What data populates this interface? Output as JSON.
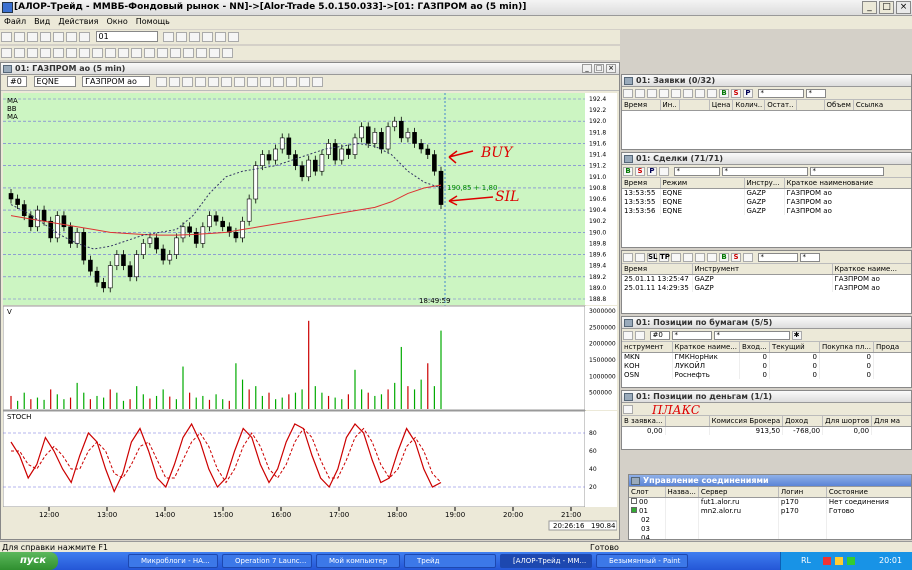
{
  "window": {
    "title": "[АЛОР-Трейд - ММВБ-Фондовый рынок - NN]->[Alor-Trade 5.0.150.033]->[01: ГАЗПРОМ ао (5 min)]"
  },
  "menu": [
    "Файл",
    "Вид",
    "Действия",
    "Окно",
    "Помощь"
  ],
  "toolbar": {
    "account_value": "01"
  },
  "chart_window": {
    "title": "01: ГАЗПРОМ ао (5 min)",
    "num_value": "#0",
    "board_value": "EQNE",
    "instrument_value": "ГАЗПРОМ ао",
    "labels": [
      "MA",
      "BB",
      "MA"
    ],
    "time_label": "18:49:59",
    "price_annotation": "190,85 + 1,80",
    "volume_label": "V",
    "stoch_label": "STOCH",
    "buy_note": "BUY",
    "sell_note": "SIL",
    "cursor_time": "20:26:16",
    "cursor_price": "190.84"
  },
  "chart_data": [
    {
      "type": "candlestick",
      "title": "ГАЗПРОМ ао (5 min)",
      "x_ticks": [
        "12:00",
        "13:00",
        "14:00",
        "15:00",
        "16:00",
        "17:00",
        "18:00",
        "19:00",
        "20:00",
        "21:00"
      ],
      "y_ticks": [
        188.8,
        189.0,
        189.2,
        189.4,
        189.6,
        189.8,
        190.0,
        190.2,
        190.4,
        190.6,
        190.8,
        191.0,
        191.2,
        191.4,
        191.6,
        191.8,
        192.0,
        192.2,
        192.4
      ],
      "ylim": [
        188.8,
        192.4
      ],
      "grid": true,
      "close": [
        190.6,
        190.5,
        190.3,
        190.1,
        190.4,
        190.2,
        189.9,
        190.3,
        190.1,
        189.8,
        190.0,
        189.5,
        189.3,
        189.1,
        189.0,
        189.4,
        189.6,
        189.4,
        189.2,
        189.6,
        189.8,
        189.9,
        189.7,
        189.5,
        189.6,
        189.9,
        190.1,
        190.0,
        189.8,
        190.1,
        190.3,
        190.2,
        190.1,
        190.0,
        189.9,
        190.2,
        190.6,
        191.2,
        191.4,
        191.3,
        191.5,
        191.7,
        191.4,
        191.2,
        191.0,
        191.3,
        191.1,
        191.4,
        191.6,
        191.3,
        191.5,
        191.4,
        191.7,
        191.9,
        191.6,
        191.8,
        191.5,
        191.9,
        192.0,
        191.7,
        191.8,
        191.6,
        191.5,
        191.4,
        191.1,
        190.5
      ],
      "ma_long": [
        190.3,
        190.25,
        190.2,
        190.15,
        190.1,
        190.05,
        190.0,
        189.98,
        189.96,
        189.95,
        189.95,
        189.96,
        189.98,
        190.0,
        190.05,
        190.1,
        190.15,
        190.2,
        190.25,
        190.3,
        190.35,
        190.4,
        190.45,
        190.55,
        190.7,
        190.8,
        190.85
      ],
      "ma_short": [
        190.5,
        190.35,
        190.15,
        189.95,
        189.8,
        189.7,
        189.75,
        189.85,
        189.95,
        190.0,
        190.05,
        190.3,
        190.7,
        191.0,
        191.1,
        191.15,
        191.2,
        191.3,
        191.4,
        191.5,
        191.55,
        191.6,
        191.55,
        191.4,
        191.1,
        190.9,
        190.8
      ]
    },
    {
      "type": "bar",
      "title": "V",
      "y_ticks": [
        500000,
        1000000,
        1500000,
        2000000,
        2500000,
        3000000
      ],
      "ylim": [
        0,
        3000000
      ],
      "values": [
        400000,
        250000,
        500000,
        300000,
        350000,
        280000,
        600000,
        450000,
        300000,
        350000,
        800000,
        500000,
        300000,
        400000,
        350000,
        600000,
        500000,
        250000,
        300000,
        700000,
        450000,
        320000,
        400000,
        600000,
        380000,
        300000,
        1300000,
        500000,
        350000,
        400000,
        280000,
        450000,
        300000,
        250000,
        1400000,
        900000,
        600000,
        700000,
        400000,
        500000,
        300000,
        350000,
        450000,
        500000,
        600000,
        2700000,
        700000,
        500000,
        400000,
        350000,
        300000,
        450000,
        1200000,
        600000,
        500000,
        400000,
        450000,
        600000,
        800000,
        1900000,
        700000,
        600000,
        900000,
        1400000,
        700000,
        2400000
      ]
    },
    {
      "type": "line",
      "title": "STOCH",
      "y_ticks": [
        20,
        40,
        60,
        80
      ],
      "ylim": [
        0,
        100
      ],
      "series": [
        {
          "values": [
            70,
            55,
            30,
            45,
            75,
            60,
            40,
            25,
            55,
            80,
            70,
            40,
            15,
            35,
            70,
            85,
            60,
            30,
            20,
            45,
            75,
            90,
            70,
            40,
            20,
            30,
            60,
            85,
            75,
            45,
            25,
            40,
            70,
            90,
            85,
            55,
            30,
            20,
            40,
            75,
            90,
            80,
            50,
            25,
            30,
            60,
            85,
            70,
            40,
            20,
            25
          ]
        },
        {
          "values": [
            60,
            60,
            45,
            40,
            55,
            65,
            55,
            40,
            40,
            60,
            70,
            60,
            35,
            30,
            45,
            65,
            70,
            50,
            30,
            30,
            50,
            70,
            80,
            65,
            40,
            25,
            40,
            65,
            80,
            65,
            40,
            30,
            45,
            70,
            85,
            75,
            50,
            30,
            30,
            50,
            75,
            85,
            70,
            45,
            30,
            40,
            65,
            75,
            60,
            35,
            25
          ]
        }
      ]
    }
  ],
  "orders_panel": {
    "title": "01: Заявки (0/32)",
    "dd1": "*",
    "dd2": "*",
    "headers": [
      "Время",
      "Ин..",
      "",
      "Цена",
      "Колич..",
      "Остат..",
      "",
      "Объем",
      "Ссылка"
    ]
  },
  "deals_panel": {
    "title": "01: Сделки (71/71)",
    "dd1": "*",
    "dd2": "*",
    "dd3": "*",
    "headers": [
      "Время",
      "Режим",
      "Инстру...",
      "Краткое наименование"
    ],
    "rows": [
      [
        "13:53:55",
        "EQNE",
        "GAZP",
        "ГАЗПРОМ ао"
      ],
      [
        "13:53:55",
        "EQNE",
        "GAZP",
        "ГАЗПРОМ ао"
      ],
      [
        "13:53:56",
        "EQNE",
        "GAZP",
        "ГАЗПРОМ ао"
      ]
    ]
  },
  "stops_panel": {
    "dd1": "*",
    "dd2": "*",
    "headers": [
      "Время",
      "Инструмент",
      "Краткое наиме..."
    ],
    "rows": [
      [
        "25.01.11  13:25:47",
        "GAZP",
        "ГАЗПРОМ ао"
      ],
      [
        "25.01.11  14:29:35",
        "GAZP",
        "ГАЗПРОМ ао"
      ]
    ]
  },
  "positions_panel": {
    "title": "01: Позиции по бумагам (5/5)",
    "num": "#0",
    "dd1": "*",
    "dd2": "*",
    "headers": [
      "нструмент",
      "Краткое наиме...",
      "Вход...",
      "Текущий",
      "Покупка пл...",
      "Прода"
    ],
    "rows": [
      [
        "MKN",
        "ГМКНорНик",
        "0",
        "0",
        "0",
        ""
      ],
      [
        "КОН",
        "ЛУКОЙЛ",
        "0",
        "0",
        "0",
        ""
      ],
      [
        "OSN",
        "Роснефть",
        "0",
        "0",
        "0",
        ""
      ]
    ]
  },
  "money_panel": {
    "title": "01: Позиции по деньгам (1/1)",
    "note": "ПЛАКС",
    "headers": [
      "В заявка...",
      "",
      "Комиссия Брокера",
      "Доход",
      "Для шортов",
      "Для ма"
    ],
    "row": [
      "0,00",
      "",
      "913,50",
      "-768,00",
      "0,00",
      ""
    ]
  },
  "connections_panel": {
    "title": "Управление соединениями",
    "headers": [
      "Слот",
      "Назва...",
      "Сервер",
      "Логин",
      "Состояние"
    ],
    "rows": [
      [
        "00",
        "",
        "fut1.alor.ru",
        "p170",
        "Нет соединения"
      ],
      [
        "01",
        "",
        "mn2.alor.ru",
        "p170",
        "Готово"
      ],
      [
        "02",
        "",
        "",
        "",
        ""
      ],
      [
        "03",
        "",
        "",
        "",
        ""
      ],
      [
        "04",
        "",
        "",
        "",
        ""
      ]
    ]
  },
  "statusbar": {
    "help": "Для справки нажмите F1",
    "state": "Готово"
  },
  "taskbar": {
    "start": "пуск",
    "tasks": [
      "Микроблоги - НА...",
      "Operation 7 Launc...",
      "Мой компьютер",
      "Трейд",
      "[АЛОР-Трейд - ММ...",
      "Безымянный - Paint"
    ],
    "lang": "RL",
    "clock": "20:01"
  }
}
